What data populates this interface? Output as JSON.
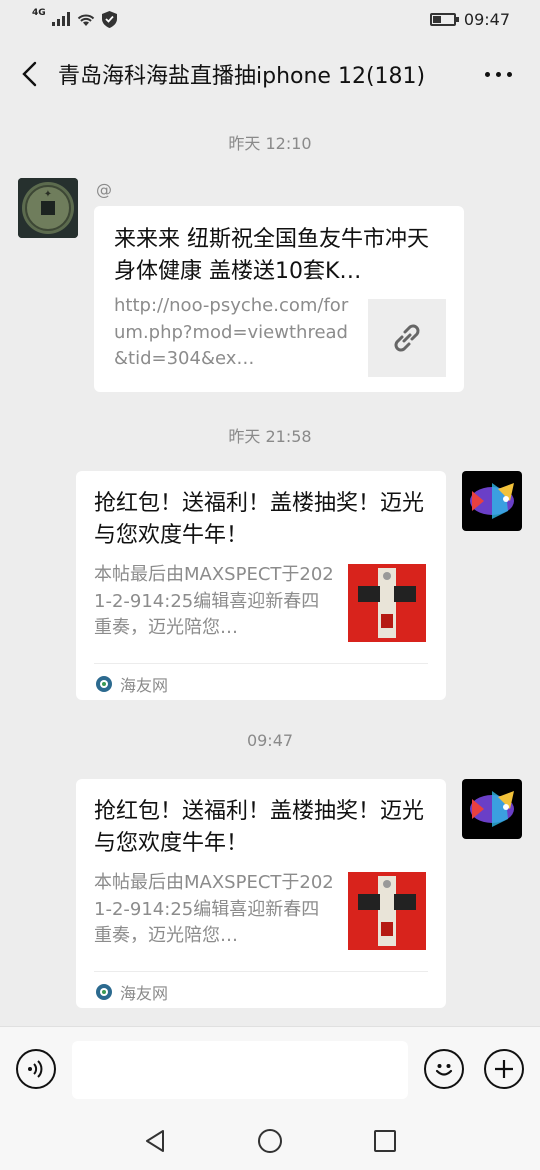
{
  "status_bar": {
    "network": "4G",
    "time": "09:47"
  },
  "header": {
    "title": "青岛海科海盐直播抽iphone 12(181)",
    "back_icon": "chevron-left-icon",
    "more_icon": "more-dots-icon"
  },
  "messages": [
    {
      "timestamp": "昨天 12:10",
      "sender": "@",
      "side": "left",
      "title": "来来来 纽斯祝全国鱼友牛市冲天 身体健康 盖楼送10套K…",
      "description": "http://noo-psyche.com/forum.php?mod=viewthread&tid=304&ex…",
      "thumb_icon": "link-icon"
    },
    {
      "timestamp": "昨天 21:58",
      "side": "right",
      "title": "抢红包！送福利！盖楼抽奖！迈光与您欢度牛年！",
      "description": "本帖最后由MAXSPECT于2021-2-914:25编辑喜迎新春四重奏，迈光陪您…",
      "source": "海友网"
    },
    {
      "timestamp": "09:47",
      "side": "right",
      "title": "抢红包！送福利！盖楼抽奖！迈光与您欢度牛年！",
      "description": "本帖最后由MAXSPECT于2021-2-914:25编辑喜迎新春四重奏，迈光陪您…",
      "source": "海友网"
    }
  ],
  "input_bar": {
    "voice_icon": "voice-icon",
    "input_value": "",
    "emoji_icon": "emoji-icon",
    "plus_icon": "plus-icon"
  },
  "nav_bar": {
    "back": "triangle-back-icon",
    "home": "circle-home-icon",
    "recents": "square-recents-icon"
  },
  "colors": {
    "background": "#ededed",
    "bubble": "#ffffff",
    "secondary_text": "#8a8a8a"
  }
}
